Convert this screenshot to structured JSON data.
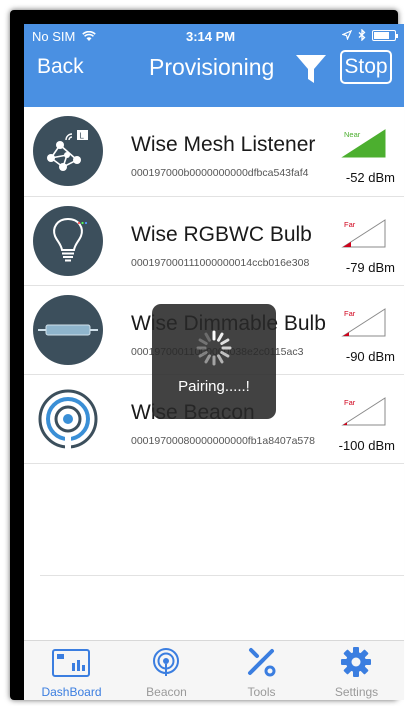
{
  "status_bar": {
    "carrier": "No SIM",
    "time": "3:14 PM"
  },
  "nav": {
    "back_label": "Back",
    "title": "Provisioning",
    "stop_label": "Stop"
  },
  "devices": [
    {
      "name": "Wise Mesh Listener",
      "mac": "000197000b0000000000dfbca543faf4",
      "proximity": "Near",
      "rssi": "-52 dBm",
      "icon": "mesh-listener-icon"
    },
    {
      "name": "Wise RGBWC Bulb",
      "mac": "000197000111000000014ccb016e308",
      "proximity": "Far",
      "rssi": "-79 dBm",
      "icon": "bulb-icon"
    },
    {
      "name": "Wise Dimmable Bulb",
      "mac": "00019700011000000038e2c0115ac3",
      "proximity": "Far",
      "rssi": "-90 dBm",
      "icon": "tube-light-icon"
    },
    {
      "name": "Wise Beacon",
      "mac": "00019700080000000000fb1a8407a578",
      "proximity": "Far",
      "rssi": "-100 dBm",
      "icon": "beacon-icon"
    }
  ],
  "overlay": {
    "message": "Pairing.....!"
  },
  "tabs": [
    {
      "label": "DashBoard",
      "icon": "dashboard-icon",
      "active": true
    },
    {
      "label": "Beacon",
      "icon": "beacon-tab-icon",
      "active": false
    },
    {
      "label": "Tools",
      "icon": "tools-icon",
      "active": false
    },
    {
      "label": "Settings",
      "icon": "gear-icon",
      "active": false
    }
  ],
  "colors": {
    "nav_blue": "#4a90e2",
    "near_green": "#4caf2f",
    "far_red": "#d0021b",
    "tab_active": "#3b7ee0"
  }
}
